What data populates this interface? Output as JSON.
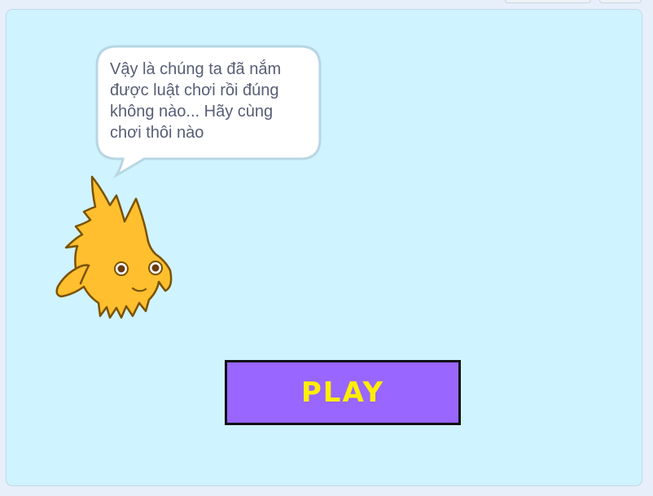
{
  "speech_bubble": {
    "text": "Vậy là chúng ta đã nắm\nđược luật chơi rồi đúng\nkhông nào... Hãy cùng\nchơi thôi nào"
  },
  "play_button": {
    "label": "PLAY"
  },
  "colors": {
    "stage_background": "#cff3ff",
    "button_background": "#9966ff",
    "button_text": "#ffee00",
    "sprite_fill": "#ffbf2e"
  },
  "sprite": {
    "icon": "flame-character-icon"
  }
}
